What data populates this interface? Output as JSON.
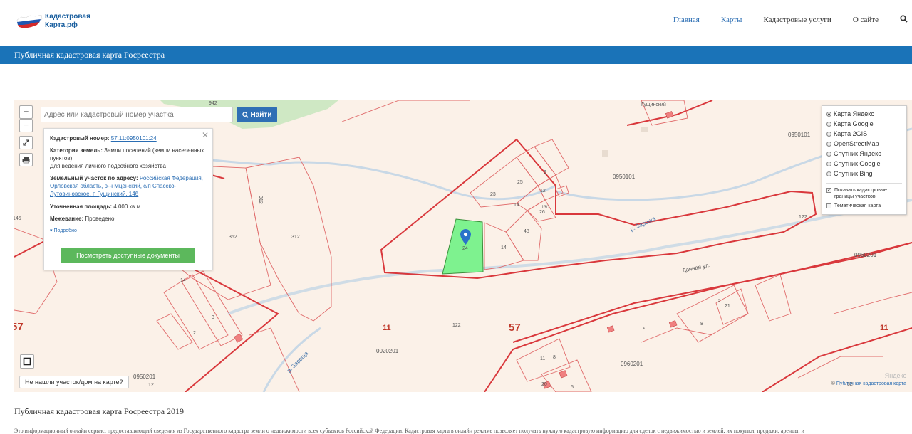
{
  "header": {
    "logo_line1": "Кадастровая",
    "logo_line2": "Карта.рф",
    "nav": [
      "Главная",
      "Карты",
      "Кадастровые услуги",
      "О сайте"
    ],
    "search_icon": "search-icon"
  },
  "banner": {
    "title": "Публичная кадастровая карта Росреестра"
  },
  "map": {
    "zoom_in": "+",
    "zoom_out": "−",
    "search_placeholder": "Адрес или кадастровый номер участка",
    "search_button": "Найти",
    "info": {
      "cadnum_label": "Кадастровый номер:",
      "cadnum_value": "57:11:0950101:24",
      "category_label": "Категория земель:",
      "category_value": "Земли поселений (земли населенных пунктов)",
      "usage": "Для ведения личного подсобного хозяйства",
      "address_label": "Земельный участок по адресу:",
      "address_value": "Российская Федерация, Орловская область, р-н Мценский, с/п Спасско-Лутовиновское, п Гущинский, 14б",
      "area_label": "Уточненная площадь:",
      "area_value": "4 000 кв.м.",
      "survey_label": "Межевание:",
      "survey_value": "Проведено",
      "more": "Подробно",
      "docs_button": "Посмотреть доступные документы"
    },
    "layers": {
      "options": [
        "Карта Яндекс",
        "Карта Google",
        "Карта 2GIS",
        "OpenStreetMap",
        "Спутник Яндекс",
        "Спутник Google",
        "Спутник Bing"
      ],
      "selected": "Карта Яндекс",
      "show_borders_line1": "Показать кадастровые",
      "show_borders_line2": "границы участков",
      "thematic": "Тематическая карта"
    },
    "not_found": "Не нашли участок/дом на карте?",
    "credit_prefix": "© ",
    "credit_link": "Публичная кадастровая карта",
    "yandex": "Яндекс",
    "labels": {
      "l942": "942",
      "l312a": "312",
      "l362": "362",
      "l312b": "312",
      "l145": "145",
      "l57a": "57",
      "l14": "14",
      "l3": "3",
      "l2": "2",
      "l11a": "11",
      "l122a": "122",
      "l57b": "57",
      "l0020201": "0020201",
      "l0950201": "0950201",
      "l12": "12",
      "l23": "23",
      "l25": "25",
      "l9": "9",
      "l12b": "12",
      "l14b": "14",
      "l26": "26",
      "l131": "13/1",
      "l48": "48",
      "l14c": "14",
      "l24": "24",
      "l0950101a": "0950101",
      "l0950101b": "0950101",
      "l122b": "122",
      "l0960201a": "0960201",
      "l0960201b": "0960201",
      "l11b": "11",
      "l11c": "11",
      "l8a": "8",
      "l20": "20",
      "l5": "5",
      "l8b": "8",
      "l21": "21",
      "l3b": "3",
      "l52": "52",
      "l4": "4",
      "gushinsky": "Гущинский",
      "zarosha1": "р. Зароща",
      "zarosha2": "р. Зароща",
      "dachnaya": "Дачная ул."
    }
  },
  "footer": {
    "title": "Публичная кадастровая карта Росреестра 2019",
    "text": "Это информационный онлайн сервис, предоставляющий сведения из Государственного кадастра земли о недвижимости всех субъектов Российской Федерации. Кадастровая карта в онлайн режиме позволяет получать нужную кадастровую информацию для сделок с недвижимостью и землей, их покупки, продажи, аренды, и"
  }
}
